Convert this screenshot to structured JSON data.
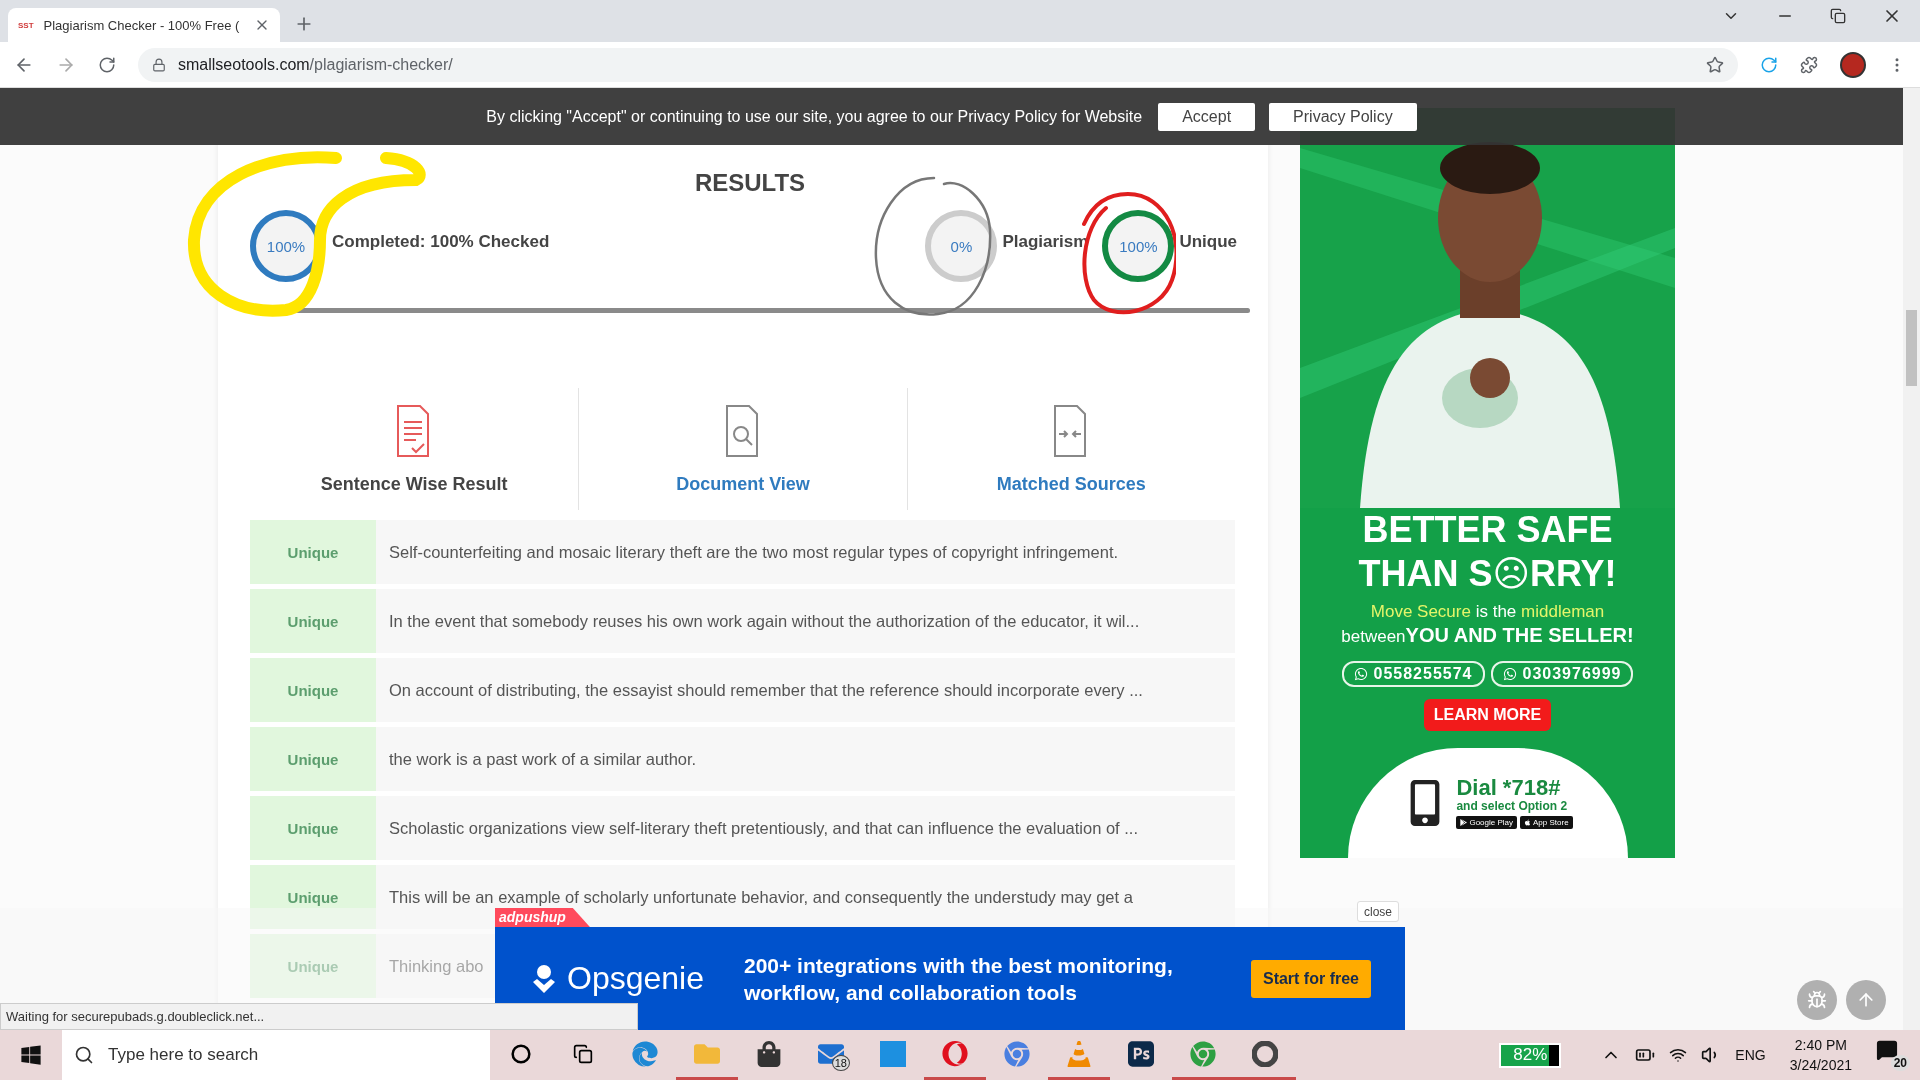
{
  "browser": {
    "tab": {
      "favicon": "SST",
      "title": "Plagiarism Checker - 100% Free (",
      "selected": true
    },
    "url": {
      "domain": "smallseotools.com",
      "path": "/plagiarism-checker/"
    }
  },
  "cookie_banner": {
    "message": "By clicking \"Accept\" or continuing to use our site, you agree to our Privacy Policy for Website",
    "buttons": [
      "Accept",
      "Privacy Policy"
    ]
  },
  "results": {
    "title": "RESULTS",
    "stats": [
      {
        "value": "100%",
        "label": "Completed: 100% Checked",
        "color": "#2f7bbf"
      },
      {
        "value": "0%",
        "label": "Plagiarism",
        "color": "#cccccc"
      },
      {
        "value": "100%",
        "label": "Unique",
        "color": "#138a43"
      }
    ],
    "annotations": [
      {
        "color": "#ffe600"
      },
      {
        "color": "#777777"
      },
      {
        "color": "#e01e1e"
      }
    ],
    "progress": {
      "level": 1
    }
  },
  "views": [
    {
      "label": "Sentence Wise Result",
      "kind": "sentences",
      "selected": true
    },
    {
      "label": "Document View",
      "kind": "document",
      "selected": false
    },
    {
      "label": "Matched Sources",
      "kind": "sources",
      "selected": false
    }
  ],
  "rows": [
    {
      "status": "Unique",
      "text": "Self-counterfeiting and mosaic literary theft are the two most regular types of copyright infringement."
    },
    {
      "status": "Unique",
      "text": "In the event that somebody reuses his own work again without the authorization of the educator, it wil..."
    },
    {
      "status": "Unique",
      "text": "On account of distributing, the essayist should remember that the reference should incorporate every ..."
    },
    {
      "status": "Unique",
      "text": "the work is a past work of a similar author."
    },
    {
      "status": "Unique",
      "text": "Scholastic organizations view self-literary theft pretentiously, and that can influence the evaluation of ..."
    },
    {
      "status": "Unique",
      "text": "This will be an example of scholarly unfortunate behavior, and consequently the understudy may get a"
    },
    {
      "status": "Unique",
      "text": "Thinking abo"
    }
  ],
  "side_ad": {
    "headline": [
      "BETTER SAFE",
      "THAN S☹RRY!"
    ],
    "tagline": [
      {
        "text": "Move Secure",
        "highlight": true
      },
      {
        "text": " is the ",
        "highlight": false
      },
      {
        "text": "middleman",
        "highlight": true
      }
    ],
    "tagline_2": [
      {
        "text": "between",
        "emphasis": false
      },
      {
        "text": "YOU AND THE SELLER!",
        "emphasis": true
      }
    ],
    "phones": [
      "0558255574",
      "0303976999"
    ],
    "button": "LEARN MORE",
    "dial": "Dial *718#",
    "dial_note": "and select Option 2",
    "stores": [
      "Google Play",
      "App Store"
    ]
  },
  "bottom_ad": {
    "tag": "adpushup",
    "brand": "Opsgenie",
    "message": "200+ integrations with the best monitoring, workflow, and collaboration tools",
    "button": "Start for free",
    "close": "close"
  },
  "status_text": "Waiting for securepubads.g.doubleclick.net...",
  "taskbar": {
    "search_placeholder": "Type here to search",
    "mail_badge": "18",
    "battery": {
      "reading": "82%",
      "level": 0.82
    },
    "language": "ENG",
    "time": "2:40 PM",
    "date": "3/24/2021",
    "notifications": "20"
  }
}
